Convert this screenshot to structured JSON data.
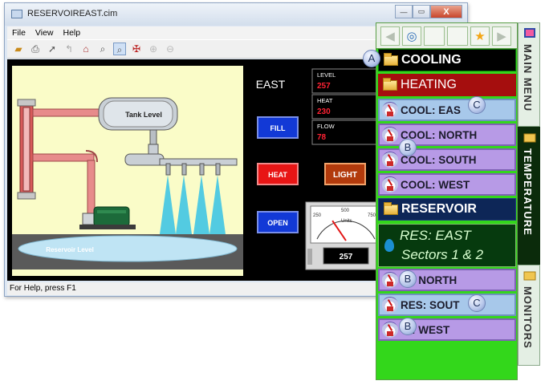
{
  "window": {
    "title": "RESERVOIREAST.cim",
    "menu": [
      "File",
      "View",
      "Help"
    ],
    "status": "For Help, press F1",
    "caption": {
      "min": "—",
      "max": "▭",
      "close": "X"
    }
  },
  "scada": {
    "tank_label": "Tank Level",
    "reservoir_label": "Reservoir Level",
    "heading": "EAST",
    "level_label": "LEVEL",
    "level_value": "257",
    "heat_label": "HEAT",
    "heat_value": "230",
    "flow_label": "FLOW",
    "flow_value": "78",
    "btn_fill": "FILL",
    "btn_heat": "HEAT",
    "btn_open": "OPEN",
    "btn_light": "LIGHT",
    "gauge_units": "Units",
    "gauge_ticks": [
      "250",
      "500",
      "750",
      "0",
      "1000"
    ],
    "gauge_readout": "257",
    "gauge_value": 257
  },
  "panel": {
    "cooling": "COOLING",
    "heating": "HEATING",
    "cool_east": "COOL: EAS",
    "cool_north": "COOL: NORTH",
    "cool_south": "COOL: SOUTH",
    "cool_west": "COOL: WEST",
    "reservoir": "RESERVOIR",
    "res_east_l1": "RES: EAST",
    "res_east_l2": "Sectors 1 & 2",
    "res_north": ": NORTH",
    "res_south": "RES: SOUT",
    "res_west": ": WEST"
  },
  "tabs": {
    "main_menu": "MAIN MENU",
    "temperature": "TEMPERATURE",
    "monitors": "MONITORS"
  },
  "badges": {
    "a": "A",
    "b": "B",
    "c": "C"
  }
}
